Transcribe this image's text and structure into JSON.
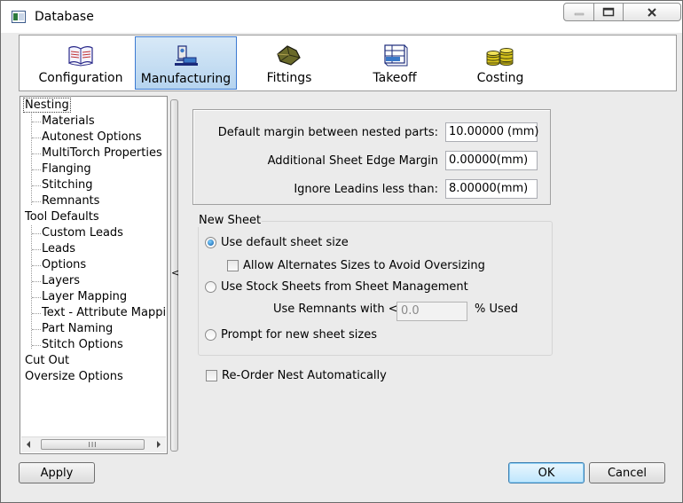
{
  "window": {
    "title": "Database"
  },
  "toolbar": {
    "tabs": [
      {
        "label": "Configuration",
        "icon": "book-icon"
      },
      {
        "label": "Manufacturing",
        "icon": "machine-icon",
        "active": true
      },
      {
        "label": "Fittings",
        "icon": "fitting-icon"
      },
      {
        "label": "Takeoff",
        "icon": "takeoff-icon"
      },
      {
        "label": "Costing",
        "icon": "coins-icon"
      }
    ]
  },
  "tree": {
    "items": [
      {
        "label": "Nesting",
        "level": 0
      },
      {
        "label": "Materials",
        "level": 1
      },
      {
        "label": "Autonest Options",
        "level": 1
      },
      {
        "label": "MultiTorch Properties",
        "level": 1
      },
      {
        "label": "Flanging",
        "level": 1
      },
      {
        "label": "Stitching",
        "level": 1
      },
      {
        "label": "Remnants",
        "level": 1
      },
      {
        "label": "Tool Defaults",
        "level": 0
      },
      {
        "label": "Custom Leads",
        "level": 1
      },
      {
        "label": "Leads",
        "level": 1
      },
      {
        "label": "Options",
        "level": 1
      },
      {
        "label": "Layers",
        "level": 1
      },
      {
        "label": "Layer Mapping",
        "level": 1
      },
      {
        "label": "Text - Attribute Mapping",
        "level": 1
      },
      {
        "label": "Part Naming",
        "level": 1
      },
      {
        "label": "Stitch Options",
        "level": 1
      },
      {
        "label": "Cut Out",
        "level": 0
      },
      {
        "label": "Oversize Options",
        "level": 0
      }
    ],
    "scroll_grip": "III"
  },
  "splitter": {
    "glyph": "<"
  },
  "margins": {
    "default_margin_label": "Default margin between nested parts:",
    "default_margin_value": "10.00000",
    "default_margin_unit": "(mm)",
    "edge_margin_label": "Additional Sheet Edge Margin",
    "edge_margin_value": "0.00000",
    "edge_margin_unit": "(mm)",
    "leadins_label": "Ignore Leadins less than:",
    "leadins_value": "8.00000",
    "leadins_unit": "(mm)"
  },
  "new_sheet": {
    "legend": "New Sheet",
    "use_default_label": "Use default sheet size",
    "allow_alternates_label": "Allow Alternates Sizes to Avoid Oversizing",
    "use_stock_label": "Use Stock Sheets from Sheet Management",
    "remnants_label": "Use Remnants with <=",
    "remnants_value": "0.0",
    "remnants_unit": "% Used",
    "prompt_label": "Prompt for new sheet sizes"
  },
  "reorder": {
    "label": "Re-Order Nest Automatically"
  },
  "buttons": {
    "apply": "Apply",
    "ok": "OK",
    "cancel": "Cancel"
  }
}
